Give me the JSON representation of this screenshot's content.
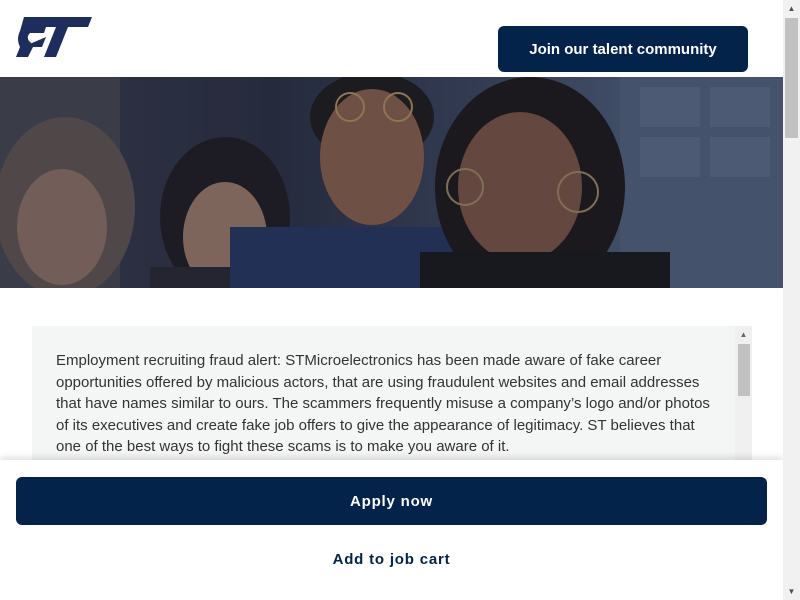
{
  "header": {
    "logo_icon": "st-logo-icon",
    "talent_button_label": "Join our talent community",
    "colors": {
      "brand_navy": "#03234b",
      "background": "#ffffff"
    }
  },
  "hero": {
    "image_icon": "people-group-photo"
  },
  "fraud_alert": {
    "text": "Employment recruiting fraud alert: STMicroelectronics has been made aware of fake career opportunities offered by malicious actors, that are using fraudulent websites and email addresses that have names similar to ours. The scammers frequently misuse a company’s logo and/or photos of its executives and create fake job offers to give the appearance of legitimacy. ST believes that one of the best ways to fight these scams is to make you aware of it."
  },
  "actions": {
    "apply_label": "Apply now",
    "cart_label": "Add to job cart"
  }
}
